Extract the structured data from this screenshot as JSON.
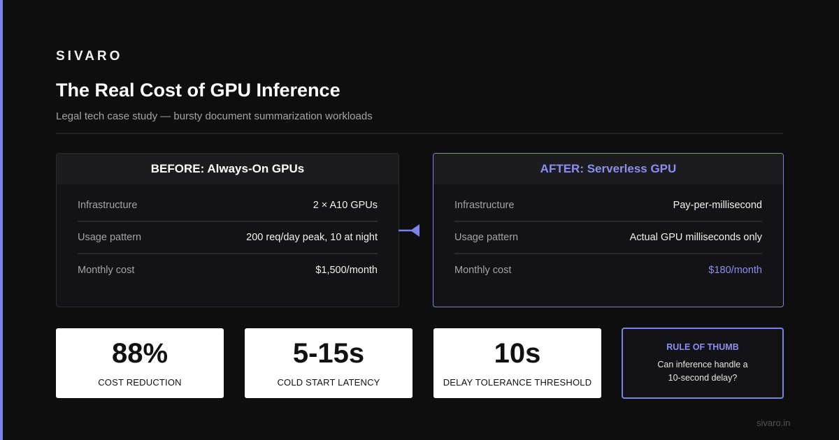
{
  "brand": "SIVARO",
  "title": "The Real Cost of GPU Inference",
  "subtitle": "Legal tech case study — bursty document summarization workloads",
  "before": {
    "header": "BEFORE: Always-On GPUs",
    "rows": [
      {
        "label": "Infrastructure",
        "value": "2 × A10 GPUs"
      },
      {
        "label": "Usage pattern",
        "value": "200 req/day peak, 10 at night"
      },
      {
        "label": "Monthly cost",
        "value": "$1,500/month"
      }
    ]
  },
  "after": {
    "header": "AFTER: Serverless GPU",
    "rows": [
      {
        "label": "Infrastructure",
        "value": "Pay-per-millisecond"
      },
      {
        "label": "Usage pattern",
        "value": "Actual GPU milliseconds only"
      },
      {
        "label": "Monthly cost",
        "value": "$180/month"
      }
    ]
  },
  "stats": [
    {
      "value": "88%",
      "caption": "COST REDUCTION"
    },
    {
      "value": "5-15s",
      "caption": "COLD START LATENCY"
    },
    {
      "value": "10s",
      "caption": "DELAY TOLERANCE THRESHOLD"
    }
  ],
  "rule_of_thumb": {
    "title": "RULE OF THUMB",
    "text": "Can inference handle a 10-second delay?"
  },
  "footer": "sivaro.in",
  "colors": {
    "accent": "#7b82e8",
    "background": "#0e0e0f",
    "card": "#ffffff"
  },
  "icons": {
    "arrow": "arrow-left-icon"
  }
}
